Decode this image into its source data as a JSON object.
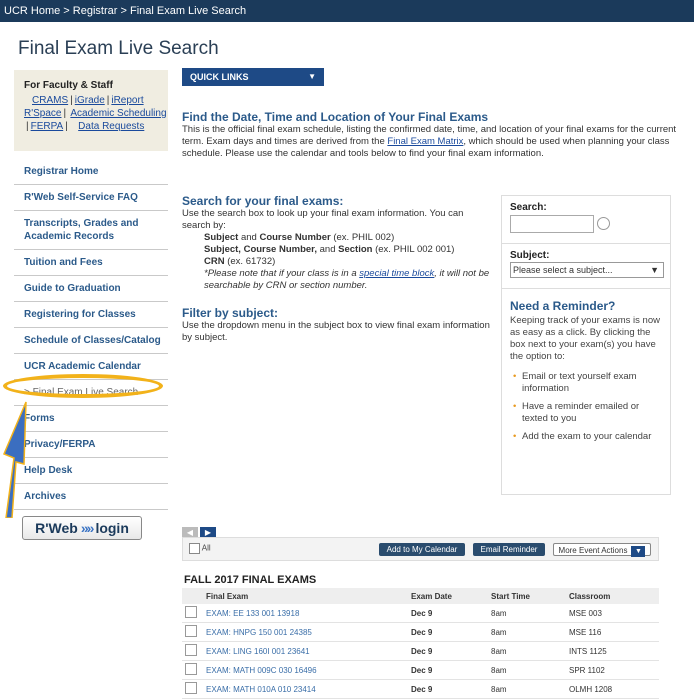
{
  "breadcrumb": {
    "items": [
      "UCR Home",
      "Registrar",
      "Final Exam Live Search"
    ],
    "separator": ">"
  },
  "page_title": "Final Exam Live Search",
  "faculty_box": {
    "title": "For Faculty & Staff",
    "links_row1": [
      "CRAMS",
      "iGrade",
      "iReport"
    ],
    "links_row2": [
      "R'Space",
      "Academic Scheduling"
    ],
    "links_row3": [
      "FERPA",
      "Data Requests"
    ]
  },
  "nav": {
    "items": [
      "Registrar Home",
      "R'Web Self-Service FAQ",
      "Transcripts, Grades and Academic Records",
      "Tuition and Fees",
      "Guide to Graduation",
      "Registering for Classes",
      "Schedule of Classes/Catalog",
      "UCR Academic Calendar",
      "> Final Exam Live Search",
      "Forms",
      "Privacy/FERPA",
      "Help Desk",
      "Archives"
    ]
  },
  "rweb_login": {
    "left": "R'Web",
    "chevrons": "»»",
    "right": "login"
  },
  "quick_links": {
    "label": "QUICK LINKS",
    "caret": "▼"
  },
  "intro": {
    "heading": "Find the Date, Time and Location of Your Final Exams",
    "text_before": "This is the official final exam schedule, listing the confirmed date, time, and location of your final exams for the current term. Exam days and times are derived from the ",
    "link": "Final Exam Matrix",
    "text_after": ", which should be used when planning your class schedule. Please use the calendar and tools below to find your final exam information."
  },
  "search_section": {
    "heading": "Search for your final exams:",
    "text": "Use the search box to look up your final exam information. You can search by:",
    "examples": [
      {
        "bold": "Subject",
        "rest": " and ",
        "bold2": "Course Number",
        "rest2": " (ex. PHIL 002)"
      },
      {
        "bold": "Subject, Course Number,",
        "rest": " and ",
        "bold2": "Section",
        "rest2": " (ex. PHIL 002 001)"
      },
      {
        "bold": "CRN",
        "rest": " (ex. 61732)",
        "bold2": "",
        "rest2": ""
      }
    ],
    "note_before": "*Please note that if your class is in a ",
    "note_link": "special time block",
    "note_after": ", it will not be searchable by CRN or section number."
  },
  "filter_section": {
    "heading": "Filter by subject:",
    "text": "Use the dropdown menu in the subject box to view final exam information by subject."
  },
  "search_box": {
    "search_label": "Search:",
    "subject_label": "Subject:",
    "subject_selected": "Please select a subject...",
    "reminder_title": "Need a Reminder?",
    "reminder_text": "Keeping track of your exams is now as easy as a click. By clicking the box next to your exam(s) you have the option to:",
    "options": [
      "Email or text yourself exam information",
      "Have a reminder emailed or texted to you",
      "Add the exam to your calendar"
    ]
  },
  "toolbar": {
    "prev": "◀",
    "next": "▶",
    "all_label": "All",
    "add_calendar": "Add to My Calendar",
    "email_reminder": "Email Reminder",
    "more_actions": "More Event Actions",
    "more_caret": "▼"
  },
  "exams": {
    "title": "FALL 2017 FINAL EXAMS",
    "columns": [
      "Final Exam",
      "Exam Date",
      "Start Time",
      "Classroom"
    ],
    "rows": [
      [
        "EXAM: EE 133 001 13918",
        "Dec 9",
        "8am",
        "MSE 003"
      ],
      [
        "EXAM: HNPG 150 001 24385",
        "Dec 9",
        "8am",
        "MSE 116"
      ],
      [
        "EXAM: LING 160I 001 23641",
        "Dec 9",
        "8am",
        "INTS 1125"
      ],
      [
        "EXAM: MATH 009C 030 16496",
        "Dec 9",
        "8am",
        "SPR 1102"
      ],
      [
        "EXAM: MATH 010A 010 23414",
        "Dec 9",
        "8am",
        "OLMH 1208"
      ]
    ]
  },
  "colors": {
    "topbar": "#1b3a5b",
    "link": "#2b5a8a",
    "highlight": "#f2b21a",
    "arrow": "#3b6ec0"
  }
}
